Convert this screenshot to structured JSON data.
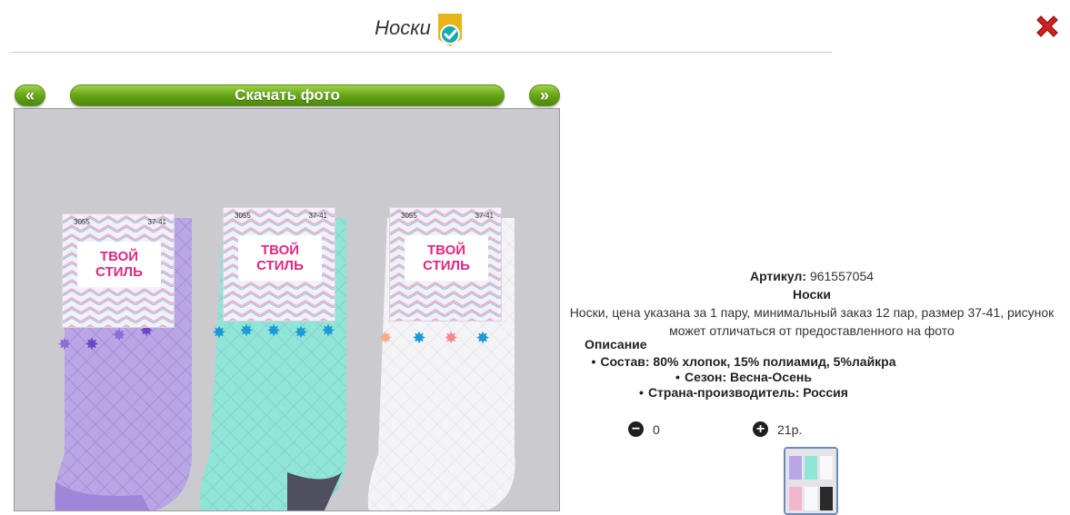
{
  "header": {
    "title": "Носки",
    "badge_icon": "approved-check-icon",
    "close_icon": "close-x-icon"
  },
  "nav": {
    "prev_label": "«",
    "download_label": "Скачать фото",
    "next_label": "»"
  },
  "product": {
    "article_label": "Артикул:",
    "article_value": "961557054",
    "name": "Носки",
    "summary": "Носки, цена указана за 1 пару, минимальный заказ 12 пар, размер 37-41, рисунок может отличаться от предоставленного на фото",
    "description_title": "Описание",
    "description_items": [
      "Состав: 80% хлопок, 15% полиамид, 5%лайкра",
      "Сезон: Весна-Осень",
      "Страна-производитель: Россия"
    ]
  },
  "controls": {
    "minus_icon": "minus-circle-icon",
    "quantity": "0",
    "plus_icon": "plus-circle-icon",
    "price": "21р."
  },
  "photo": {
    "tags": [
      {
        "brand": "ТВОЙ СТИЛЬ",
        "code": "3055",
        "size": "37-41",
        "sock_color": "#b9a6e6"
      },
      {
        "brand": "ТВОЙ СТИЛЬ",
        "code": "3055",
        "size": "37-41",
        "sock_color": "#8fe5d6"
      },
      {
        "brand": "ТВОЙ СТИЛЬ",
        "code": "3055",
        "size": "37-41",
        "sock_color": "#f4f4f6"
      }
    ]
  },
  "colors": {
    "button_green": "#66a517",
    "close_red": "#d22020",
    "badge_gold": "#e8b418",
    "badge_teal": "#17a9b5"
  }
}
